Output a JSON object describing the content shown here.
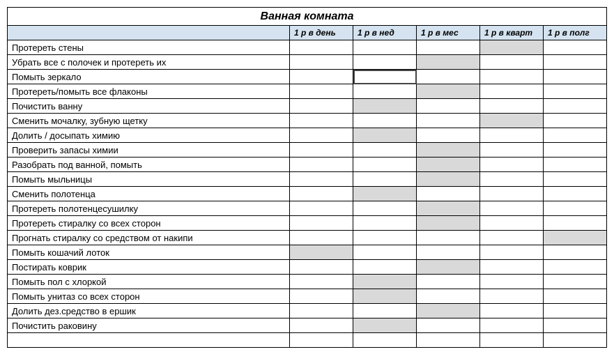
{
  "title": "Ванная комната",
  "headers": {
    "task": "",
    "c1": "1 р в день",
    "c2": "1 р в нед",
    "c3": "1 р в мес",
    "c4": "1 р в кварт",
    "c5": "1 р в полг"
  },
  "rows": [
    {
      "task": "Протереть стены",
      "shaded": [
        4
      ]
    },
    {
      "task": "Убрать все с полочек и протереть их",
      "shaded": [
        3
      ]
    },
    {
      "task": "Помыть зеркало",
      "shaded": [],
      "selected": 2
    },
    {
      "task": "Протереть/помыть все флаконы",
      "shaded": [
        3
      ]
    },
    {
      "task": "Почистить ванну",
      "shaded": [
        2
      ]
    },
    {
      "task": "Сменить мочалку, зубную щетку",
      "shaded": [
        4
      ]
    },
    {
      "task": "Долить / досыпать химию",
      "shaded": [
        2
      ]
    },
    {
      "task": "Проверить запасы химии",
      "shaded": [
        3
      ]
    },
    {
      "task": "Разобрать под ванной, помыть",
      "shaded": [
        3
      ]
    },
    {
      "task": "Помыть мыльницы",
      "shaded": [
        3
      ]
    },
    {
      "task": "Сменить полотенца",
      "shaded": [
        2
      ]
    },
    {
      "task": "Протереть полотенцесушилку",
      "shaded": [
        3
      ]
    },
    {
      "task": "Протереть стиралку со всех сторон",
      "shaded": [
        3
      ]
    },
    {
      "task": "Прогнать стиралку со средством от накипи",
      "shaded": [
        5
      ]
    },
    {
      "task": "Помыть кошачий лоток",
      "shaded": [
        1
      ]
    },
    {
      "task": "Постирать коврик",
      "shaded": [
        3
      ]
    },
    {
      "task": "Помыть пол с хлоркой",
      "shaded": [
        2
      ]
    },
    {
      "task": "Помыть унитаз со всех сторон",
      "shaded": [
        2
      ]
    },
    {
      "task": "Долить дез.средство в ершик",
      "shaded": [
        3
      ]
    },
    {
      "task": "Почистить раковину",
      "shaded": [
        2
      ]
    },
    {
      "task": "",
      "shaded": []
    }
  ]
}
